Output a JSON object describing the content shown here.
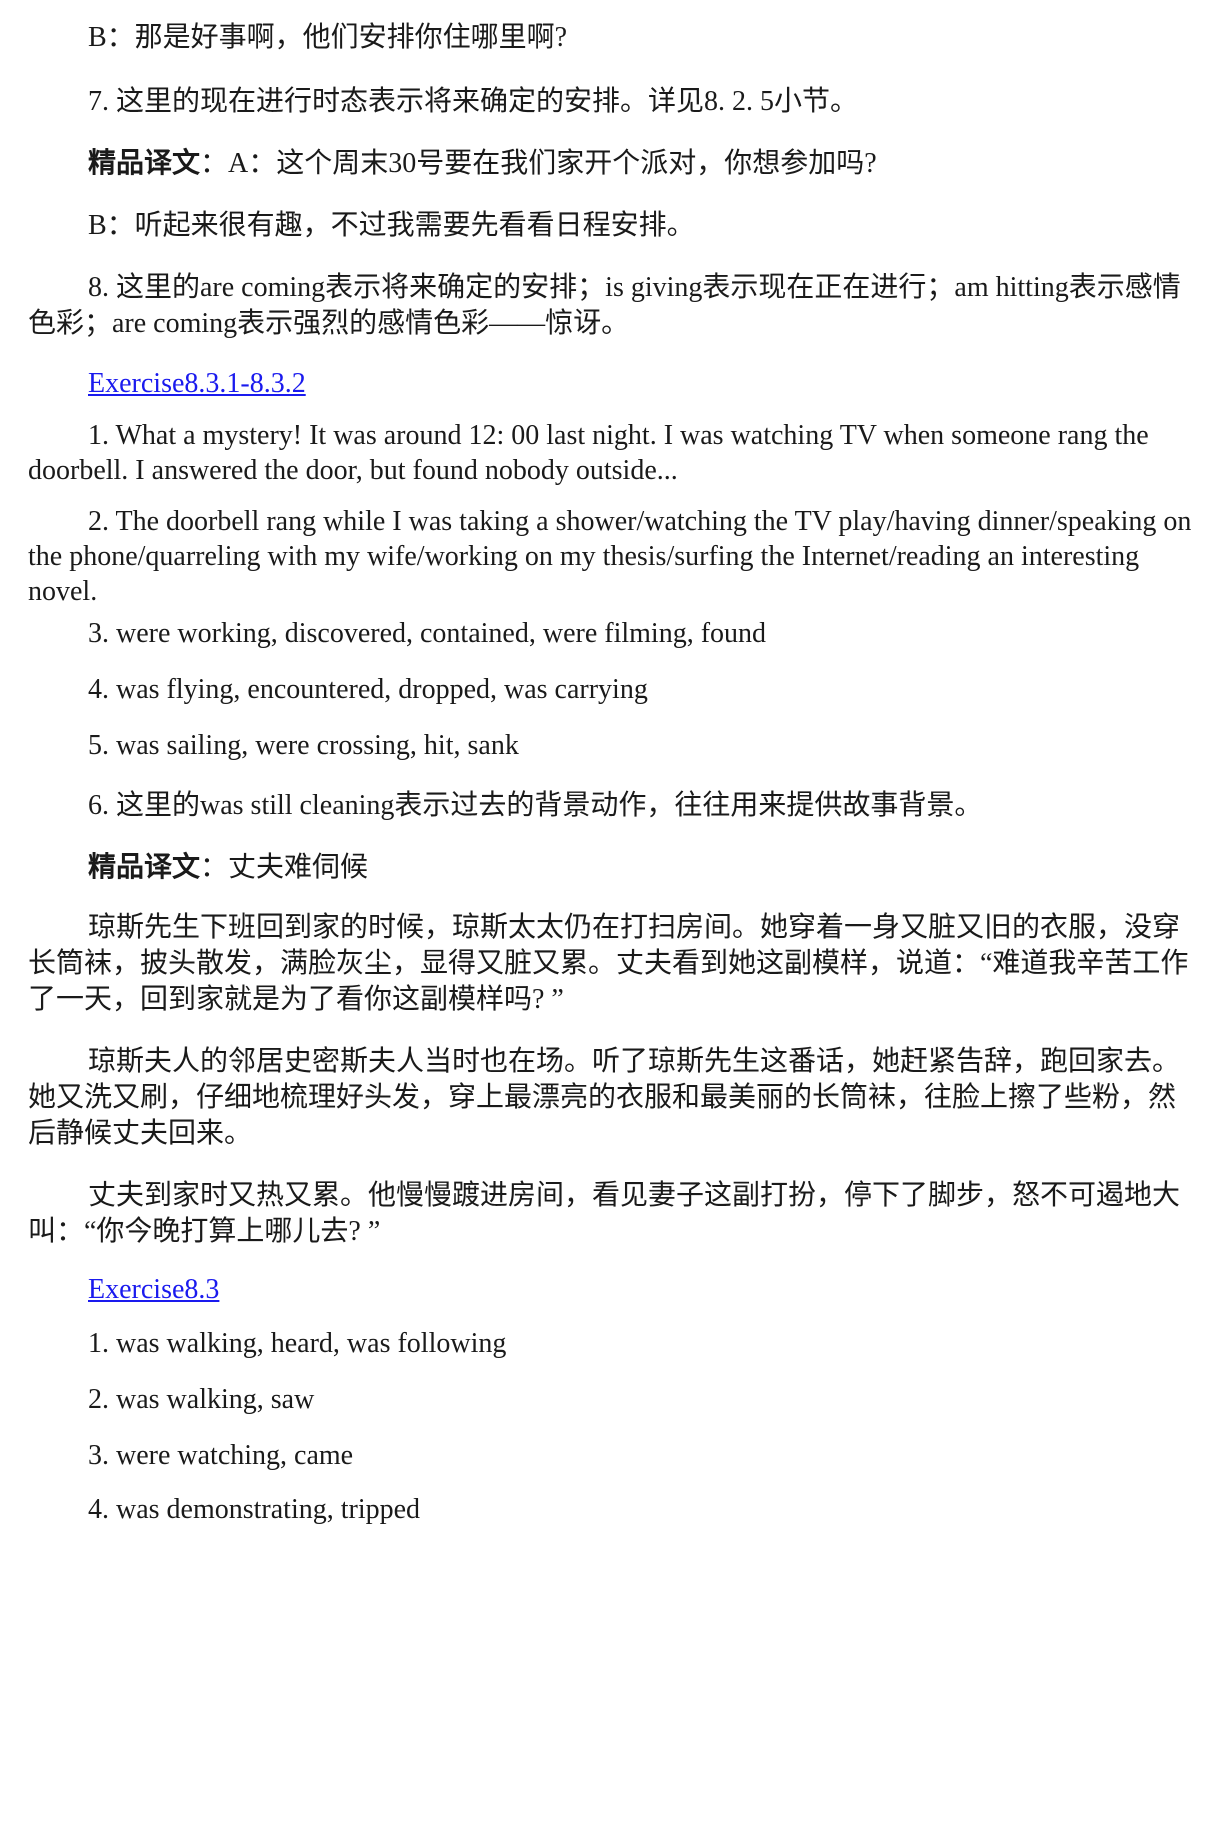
{
  "lines": {
    "l1": "B：那是好事啊，他们安排你住哪里啊?",
    "l2": "7. 这里的现在进行时态表示将来确定的安排。详见8. 2. 5小节。",
    "l3_label": "精品译文",
    "l3_rest": "：A：这个周末30号要在我们家开个派对，你想参加吗?",
    "l4": "B：听起来很有趣，不过我需要先看看日程安排。",
    "l5": "8. 这里的are coming表示将来确定的安排；is giving表示现在正在进行；am hitting表示感情色彩；are coming表示强烈的感情色彩——惊讶。",
    "link1": "Exercise8.3.1-8.3.2",
    "e1": "1. What a mystery! It was around 12: 00 last night. I was watching TV when someone rang the doorbell. I answered the door, but found nobody outside...",
    "e2": "2. The doorbell rang while I was taking a shower/watching the TV play/having dinner/speaking on the phone/quarreling with my wife/working on my thesis/surfing the Internet/reading an interesting novel.",
    "e3": "3. were working, discovered, contained, were filming, found",
    "e4": "4. was flying, encountered, dropped, was carrying",
    "e5": "5. was sailing, were crossing, hit, sank",
    "e6": "6. 这里的was still cleaning表示过去的背景动作，往往用来提供故事背景。",
    "e7_label": "精品译文",
    "e7_rest": "：丈夫难伺候",
    "para1": "琼斯先生下班回到家的时候，琼斯太太仍在打扫房间。她穿着一身又脏又旧的衣服，没穿长筒袜，披头散发，满脸灰尘，显得又脏又累。丈夫看到她这副模样，说道：“难道我辛苦工作了一天，回到家就是为了看你这副模样吗? ”",
    "para2": "琼斯夫人的邻居史密斯夫人当时也在场。听了琼斯先生这番话，她赶紧告辞，跑回家去。她又洗又刷，仔细地梳理好头发，穿上最漂亮的衣服和最美丽的长筒袜，往脸上擦了些粉，然后静候丈夫回来。",
    "para3": "丈夫到家时又热又累。他慢慢踱进房间，看见妻子这副打扮，停下了脚步，怒不可遏地大叫：“你今晚打算上哪儿去? ”",
    "link2": "Exercise8.3",
    "f1": "1. was walking, heard, was following",
    "f2": "2. was walking, saw",
    "f3": "3. were watching, came",
    "f4": "4. was demonstrating, tripped"
  },
  "colors": {
    "text": "#1a1a1a",
    "link": "#1a1aee",
    "background": "#ffffff"
  }
}
